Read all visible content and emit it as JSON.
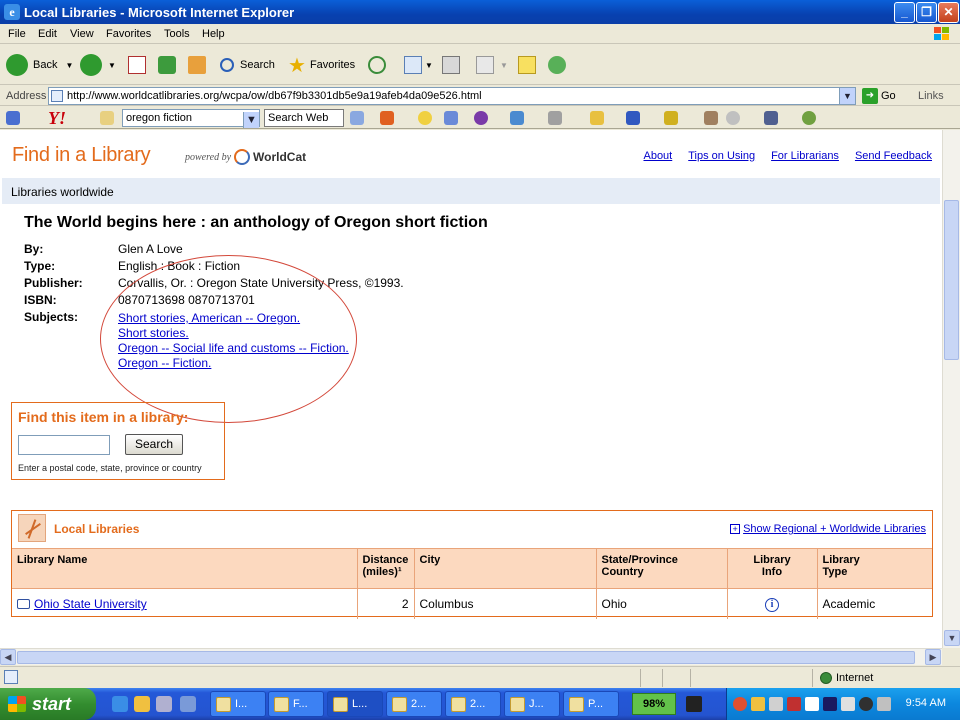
{
  "window": {
    "title": "Local Libraries - Microsoft Internet Explorer"
  },
  "menu": [
    "File",
    "Edit",
    "View",
    "Favorites",
    "Tools",
    "Help"
  ],
  "toolbar": {
    "back_label": "Back",
    "search_label": "Search",
    "favorites_label": "Favorites"
  },
  "address": {
    "label": "Address",
    "url": "http://www.worldcatlibraries.org/wcpa/ow/db67f9b3301db5e9a19afeb4da09e526.html",
    "go_label": "Go",
    "links_label": "Links"
  },
  "yahoo": {
    "search_value": "oregon fiction",
    "search_web_label": "Search Web"
  },
  "page": {
    "brand": "Find in a Library",
    "powered_by": "powered by",
    "worldcat": "WorldCat",
    "top_links": [
      "About",
      "Tips on Using",
      "For Librarians",
      "Send Feedback"
    ],
    "strip_label": "Libraries worldwide",
    "book": {
      "title": "The World begins here : an anthology of Oregon short fiction",
      "fields": [
        {
          "label": "By:",
          "value": "Glen A Love"
        },
        {
          "label": "Type:",
          "value": "English : Book : Fiction"
        },
        {
          "label": "Publisher:",
          "value": "Corvallis, Or. : Oregon State University Press, ©1993."
        },
        {
          "label": "ISBN:",
          "value": "0870713698 0870713701"
        },
        {
          "label": "Subjects:",
          "value": ""
        }
      ],
      "subjects": [
        "Short stories, American -- Oregon.",
        "Short stories.",
        "Oregon -- Social life and customs -- Fiction.",
        "Oregon -- Fiction."
      ]
    },
    "find_box": {
      "title": "Find this item in a library:",
      "search_label": "Search",
      "input_value": "",
      "hint": "Enter a postal code, state, province or country"
    },
    "local_libraries": {
      "title": "Local Libraries",
      "show_link": "Show Regional + Worldwide Libraries",
      "columns": [
        [
          "Library Name",
          ""
        ],
        [
          "Distance",
          "(miles)¹"
        ],
        [
          "City",
          ""
        ],
        [
          "State/Province",
          "Country"
        ],
        [
          "Library",
          "Info"
        ],
        [
          "Library",
          "Type"
        ]
      ],
      "rows": [
        {
          "name": "Ohio State University",
          "distance": "2",
          "city": "Columbus",
          "state": "Ohio",
          "type": "Academic"
        }
      ]
    }
  },
  "status": {
    "zone": "Internet"
  },
  "taskbar": {
    "start_label": "start",
    "tasks": [
      "I...",
      "F...",
      "L...",
      "2...",
      "2...",
      "J...",
      "P..."
    ],
    "battery": "98%",
    "clock": "9:54 AM"
  }
}
